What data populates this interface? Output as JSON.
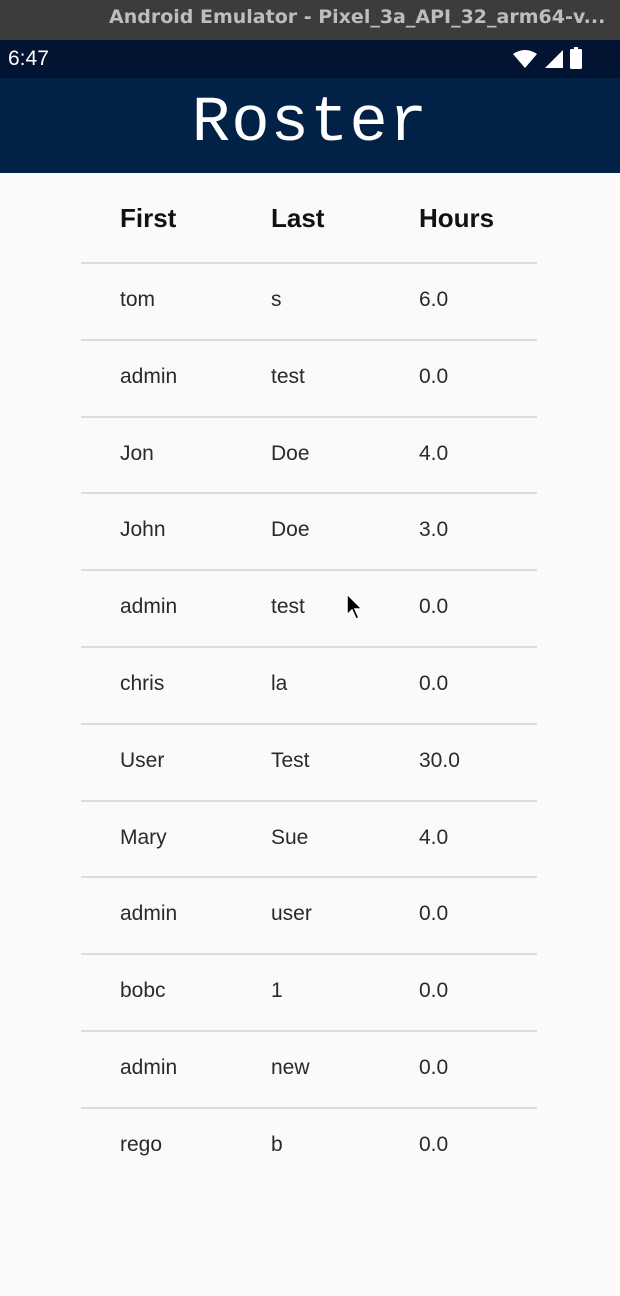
{
  "window": {
    "title": "Android Emulator - Pixel_3a_API_32_arm64-v..."
  },
  "status_bar": {
    "time": "6:47"
  },
  "app_bar": {
    "title": "Roster"
  },
  "table": {
    "headers": [
      "First",
      "Last",
      "Hours"
    ],
    "rows": [
      [
        "tom",
        "s",
        "6.0"
      ],
      [
        "admin",
        "test",
        "0.0"
      ],
      [
        "Jon",
        "Doe",
        "4.0"
      ],
      [
        "John",
        "Doe",
        "3.0"
      ],
      [
        "admin",
        "test",
        "0.0"
      ],
      [
        "chris",
        "la",
        "0.0"
      ],
      [
        "User",
        "Test",
        "30.0"
      ],
      [
        "Mary",
        "Sue",
        "4.0"
      ],
      [
        "admin",
        "user",
        "0.0"
      ],
      [
        "bobc",
        "1",
        "0.0"
      ],
      [
        "admin",
        "new",
        "0.0"
      ],
      [
        "rego",
        "b",
        "0.0"
      ]
    ]
  },
  "icons": {
    "status": [
      "wifi-icon",
      "cellular-signal-icon",
      "battery-icon"
    ],
    "pointer": "mouse-cursor-icon"
  },
  "colors": {
    "status_bar": "#021431",
    "app_bar": "#022146",
    "background": "#fafafa",
    "divider": "#dcdcdc"
  }
}
